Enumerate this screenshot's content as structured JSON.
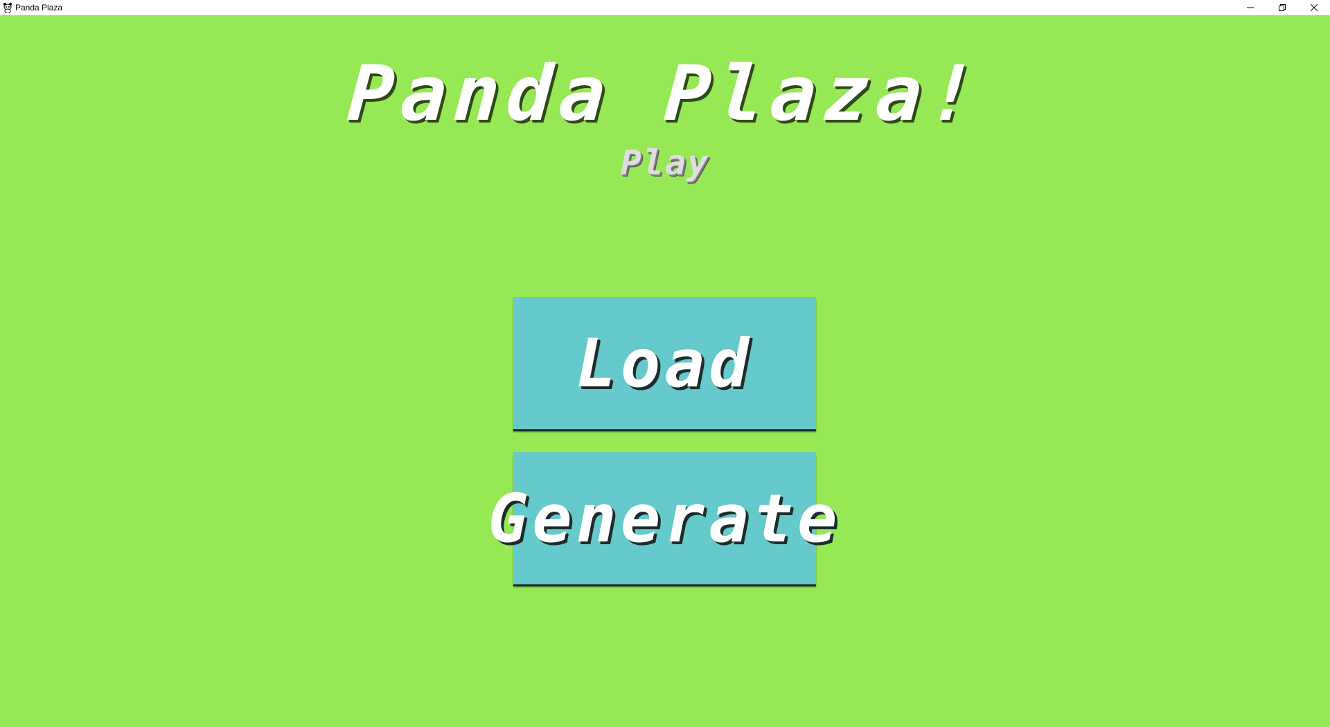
{
  "window": {
    "title": "Panda Plaza",
    "icon": "panda-app-icon",
    "controls": [
      "minimize-icon",
      "restore-icon",
      "close-icon"
    ]
  },
  "game": {
    "title": "Panda Plaza!",
    "subtitle": "Play",
    "buttons": [
      {
        "id": "load",
        "label": "Load"
      },
      {
        "id": "generate",
        "label": "Generate"
      }
    ]
  },
  "colors": {
    "background": "#96e855",
    "button": "#66c9cb",
    "text": "#ffffff",
    "subtitle": "#dedede"
  }
}
